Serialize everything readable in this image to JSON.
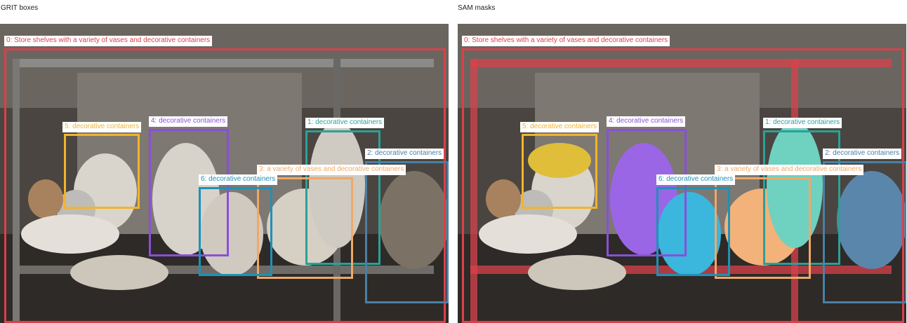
{
  "titles": {
    "left": "GRIT boxes",
    "right": "SAM masks"
  },
  "labels": [
    "0: Store shelves with a variety of vases and decorative containers",
    "1: decorative containers",
    "2: decorative containers",
    "3: a variety of vases and decorative containers",
    "4: decorative containers",
    "5: decorative containers",
    "6: decorative containers"
  ],
  "colors": {
    "box0": "#d9414b",
    "box1": "#2aa198",
    "box2": "#4b7fa3",
    "box3": "#f0a868",
    "box4": "#8a4fd8",
    "box5": "#f1b52b",
    "box6": "#1d92b8"
  }
}
